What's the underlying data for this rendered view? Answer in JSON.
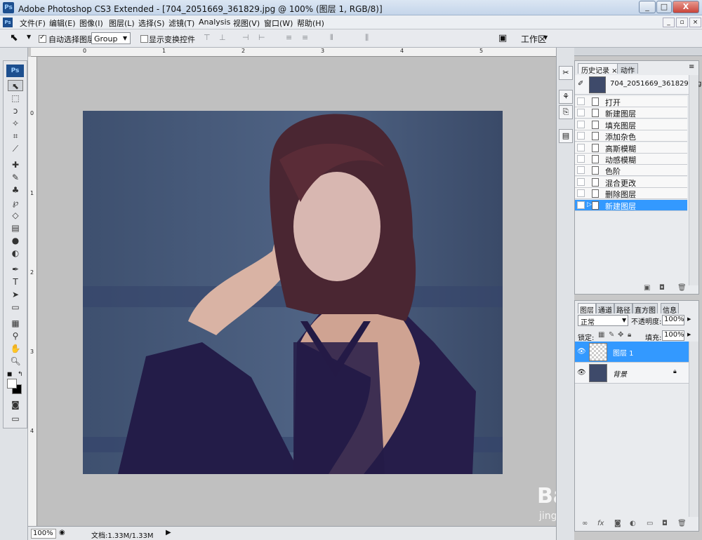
{
  "window": {
    "app_icon": "Ps",
    "title": "Adobe Photoshop CS3 Extended - [704_2051669_361829.jpg @ 100% (图层 1, RGB/8)]",
    "min": "_",
    "max": "□",
    "close": "X"
  },
  "menu": {
    "items": [
      "文件(F)",
      "编辑(E)",
      "图像(I)",
      "图层(L)",
      "选择(S)",
      "滤镜(T)",
      "Analysis",
      "视图(V)",
      "窗口(W)",
      "帮助(H)"
    ],
    "mdi_min": "_",
    "mdi_restore": "▫",
    "mdi_close": "×"
  },
  "options": {
    "auto_select_label": "自动选择图层",
    "auto_select_value": "Group",
    "show_transform_label": "显示变换控件",
    "workspace_label": "工作区"
  },
  "ruler": {
    "top_labels": [
      "0",
      "1",
      "2",
      "3",
      "4",
      "5"
    ],
    "left_labels": [
      "0",
      "1",
      "2",
      "3",
      "4"
    ]
  },
  "status": {
    "zoom": "100%",
    "doc_info": "文档:1.33M/1.33M"
  },
  "history": {
    "tabs": [
      "历史记录",
      "动作"
    ],
    "snapshot_name": "704_2051669_361829.jpg",
    "items": [
      "打开",
      "新建图层",
      "填充图层",
      "添加杂色",
      "高斯模糊",
      "动感模糊",
      "色阶",
      "混合更改",
      "删除图层",
      "新建图层"
    ],
    "selected_index": 9
  },
  "layers": {
    "tabs": [
      "图层",
      "通道",
      "路径",
      "直方图",
      "信息"
    ],
    "blend_mode": "正常",
    "opacity_label": "不透明度:",
    "opacity_value": "100%",
    "lock_label": "锁定:",
    "fill_label": "填充:",
    "fill_value": "100%",
    "items": [
      {
        "name": "图层 1",
        "selected": true
      },
      {
        "name": "背景",
        "selected": false
      }
    ]
  },
  "watermark": {
    "text": "Baidu经验",
    "url": "jingyan.baidu.com"
  },
  "colors": {
    "accent": "#3399ff",
    "photo_bg": "#4a5b7c"
  }
}
